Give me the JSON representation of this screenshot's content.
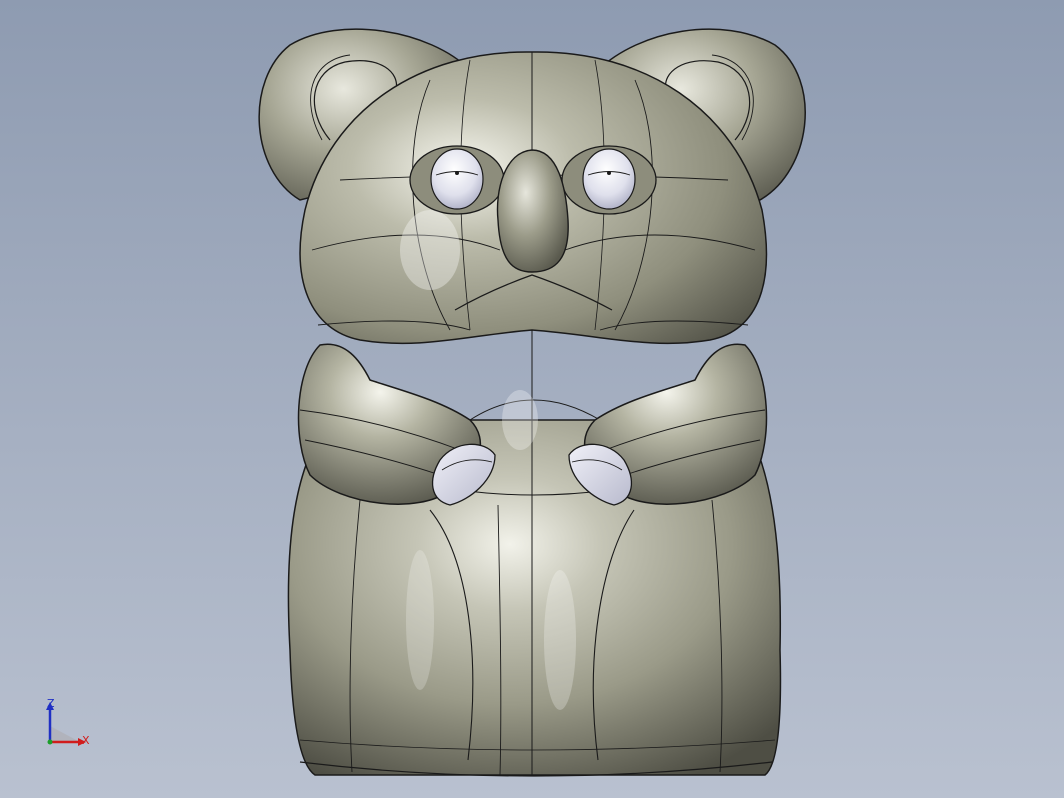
{
  "viewport": {
    "background_top": "#8e9bb1",
    "background_bottom": "#b9c1d0",
    "model": {
      "name": "koala",
      "surface_color": "#a3a392",
      "edge_color": "#1a1a1a",
      "accent_surface_color": "#dcdde8"
    }
  },
  "triad": {
    "z_label": "Z",
    "x_label": "X",
    "z_color": "#1f2fc4",
    "x_color": "#d11c1c"
  }
}
